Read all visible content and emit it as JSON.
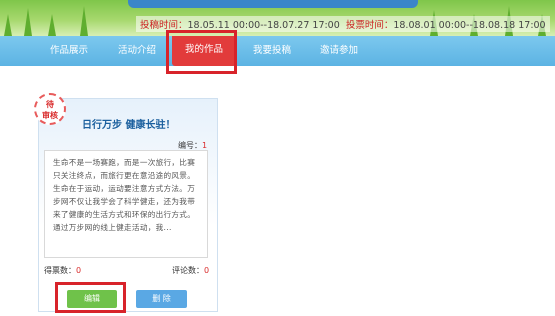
{
  "header": {
    "submit_label": "投稿时间：",
    "submit_range": "18.05.11 00:00--18.07.27 17:00",
    "vote_label": "投票时间：",
    "vote_range": "18.08.01 00:00--18.08.18 17:00"
  },
  "nav": {
    "items": [
      {
        "label": "作品展示"
      },
      {
        "label": "活动介绍"
      },
      {
        "label": "我的作品"
      },
      {
        "label": "我要投稿"
      },
      {
        "label": "邀请参加"
      }
    ],
    "active_index": 2
  },
  "card": {
    "badge": "待审核",
    "title": "日行万步 健康长驻！",
    "id_label": "编号：",
    "id_value": "1",
    "description": "生命不是一场赛跑，而是一次旅行，比赛只关注终点，而旅行更在意沿途的风景。生命在于运动，运动要注意方式方法。万步网不仅让我学会了科学健走，还为我带来了健康的生活方式和环保的出行方式。通过万步网的线上健走活动，我...",
    "votes_label": "得票数：",
    "votes_value": "0",
    "comments_label": "评论数：",
    "comments_value": "0",
    "edit_label": "编辑",
    "delete_label": "删 除"
  },
  "colors": {
    "nav_bg": "#5cb3e3",
    "active_tab": "#e23b3b",
    "highlight": "#d8232a",
    "edit_button": "#6fc24a",
    "delete_button": "#5aa8e4",
    "title": "#1a5f9e"
  }
}
